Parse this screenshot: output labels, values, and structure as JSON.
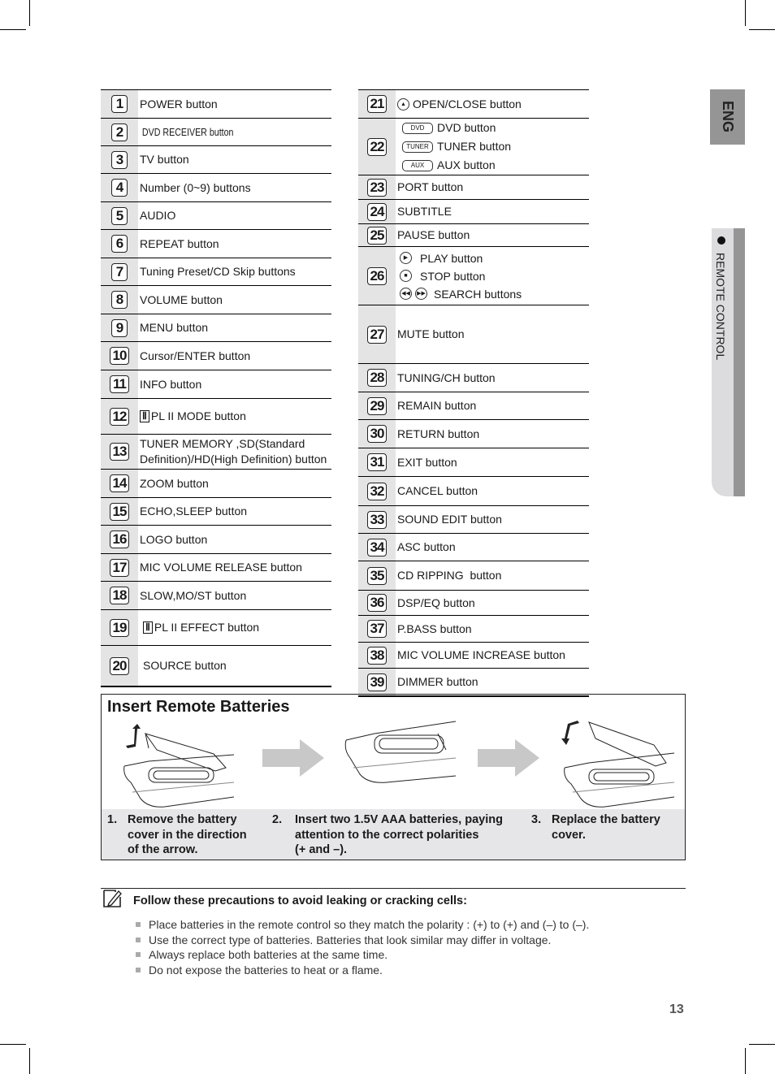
{
  "side_tabs": {
    "language": "ENG",
    "section": "REMOTE CONTROL"
  },
  "buttons_left": [
    {
      "num": "1",
      "label": "POWER button"
    },
    {
      "num": "2",
      "label": "DVD RECEIVER button"
    },
    {
      "num": "3",
      "label": "TV button"
    },
    {
      "num": "4",
      "label": "Number (0~9) buttons"
    },
    {
      "num": "5",
      "label": "AUDIO"
    },
    {
      "num": "6",
      "label": "REPEAT button"
    },
    {
      "num": "7",
      "label": "Tuning Preset/CD Skip buttons"
    },
    {
      "num": "8",
      "label": "VOLUME button"
    },
    {
      "num": "9",
      "label": "MENU button"
    },
    {
      "num": "10",
      "label": "Cursor/ENTER button"
    },
    {
      "num": "11",
      "label": "INFO button"
    },
    {
      "num": "12",
      "label": "PL II MODE button",
      "icon": "dolby-icon"
    },
    {
      "num": "13",
      "label": "TUNER MEMORY ,SD(Standard",
      "label2": "Definition)/HD(High Definition) button"
    },
    {
      "num": "14",
      "label": "ZOOM button"
    },
    {
      "num": "15",
      "label": "ECHO,SLEEP button"
    },
    {
      "num": "16",
      "label": "LOGO button"
    },
    {
      "num": "17",
      "label": "MIC VOLUME RELEASE button"
    },
    {
      "num": "18",
      "label": "SLOW,MO/ST button"
    },
    {
      "num": "19",
      "label": "PL II EFFECT button",
      "icon": "dolby-icon"
    },
    {
      "num": "20",
      "label": "SOURCE button"
    }
  ],
  "buttons_right": [
    {
      "num": "21",
      "label": "OPEN/CLOSE button",
      "icon": "eject-icon"
    },
    {
      "num": "22",
      "items": [
        {
          "pill": "DVD",
          "label": "DVD button"
        },
        {
          "pill": "TUNER",
          "label": "TUNER button"
        },
        {
          "pill": "AUX",
          "label": "AUX button"
        }
      ]
    },
    {
      "num": "23",
      "label": "PORT button"
    },
    {
      "num": "24",
      "label": "SUBTITLE"
    },
    {
      "num": "25",
      "label": "PAUSE button"
    },
    {
      "num": "26",
      "items": [
        {
          "icon": "play-icon",
          "label": "PLAY button"
        },
        {
          "icon": "stop-icon",
          "label": "STOP button"
        },
        {
          "icon": "search-icons",
          "label": "SEARCH buttons"
        }
      ]
    },
    {
      "num": "27",
      "label": "MUTE button"
    },
    {
      "num": "28",
      "label": "TUNING/CH button"
    },
    {
      "num": "29",
      "label": "REMAIN button"
    },
    {
      "num": "30",
      "label": "RETURN button"
    },
    {
      "num": "31",
      "label": "EXIT button"
    },
    {
      "num": "32",
      "label": "CANCEL button"
    },
    {
      "num": "33",
      "label": "SOUND EDIT button"
    },
    {
      "num": "34",
      "label": "ASC button"
    },
    {
      "num": "35",
      "label": "CD RIPPING  button"
    },
    {
      "num": "36",
      "label": "DSP/EQ button"
    },
    {
      "num": "37",
      "label": "P.BASS button"
    },
    {
      "num": "38",
      "label": "MIC VOLUME INCREASE button"
    },
    {
      "num": "39",
      "label": "DIMMER button"
    }
  ],
  "batteries": {
    "title": "Insert Remote Batteries",
    "steps": [
      {
        "n": "1.",
        "text": [
          "Remove the battery",
          "cover in the direction",
          "of the arrow."
        ]
      },
      {
        "n": "2.",
        "text": [
          "Insert two 1.5V AAA batteries, paying",
          "attention to the correct polarities",
          "(+ and –)."
        ]
      },
      {
        "n": "3.",
        "text": [
          "Replace the battery",
          "cover."
        ]
      }
    ]
  },
  "note": {
    "title": "Follow these precautions to avoid leaking or cracking cells:",
    "bullets": [
      "Place batteries in the remote control so they match the polarity : (+) to (+) and (–) to (–).",
      "Use the correct type of batteries. Batteries that look similar may differ in voltage.",
      "Always replace both batteries at the same time.",
      "Do not expose the batteries to heat or a flame."
    ]
  },
  "page_number": "13"
}
